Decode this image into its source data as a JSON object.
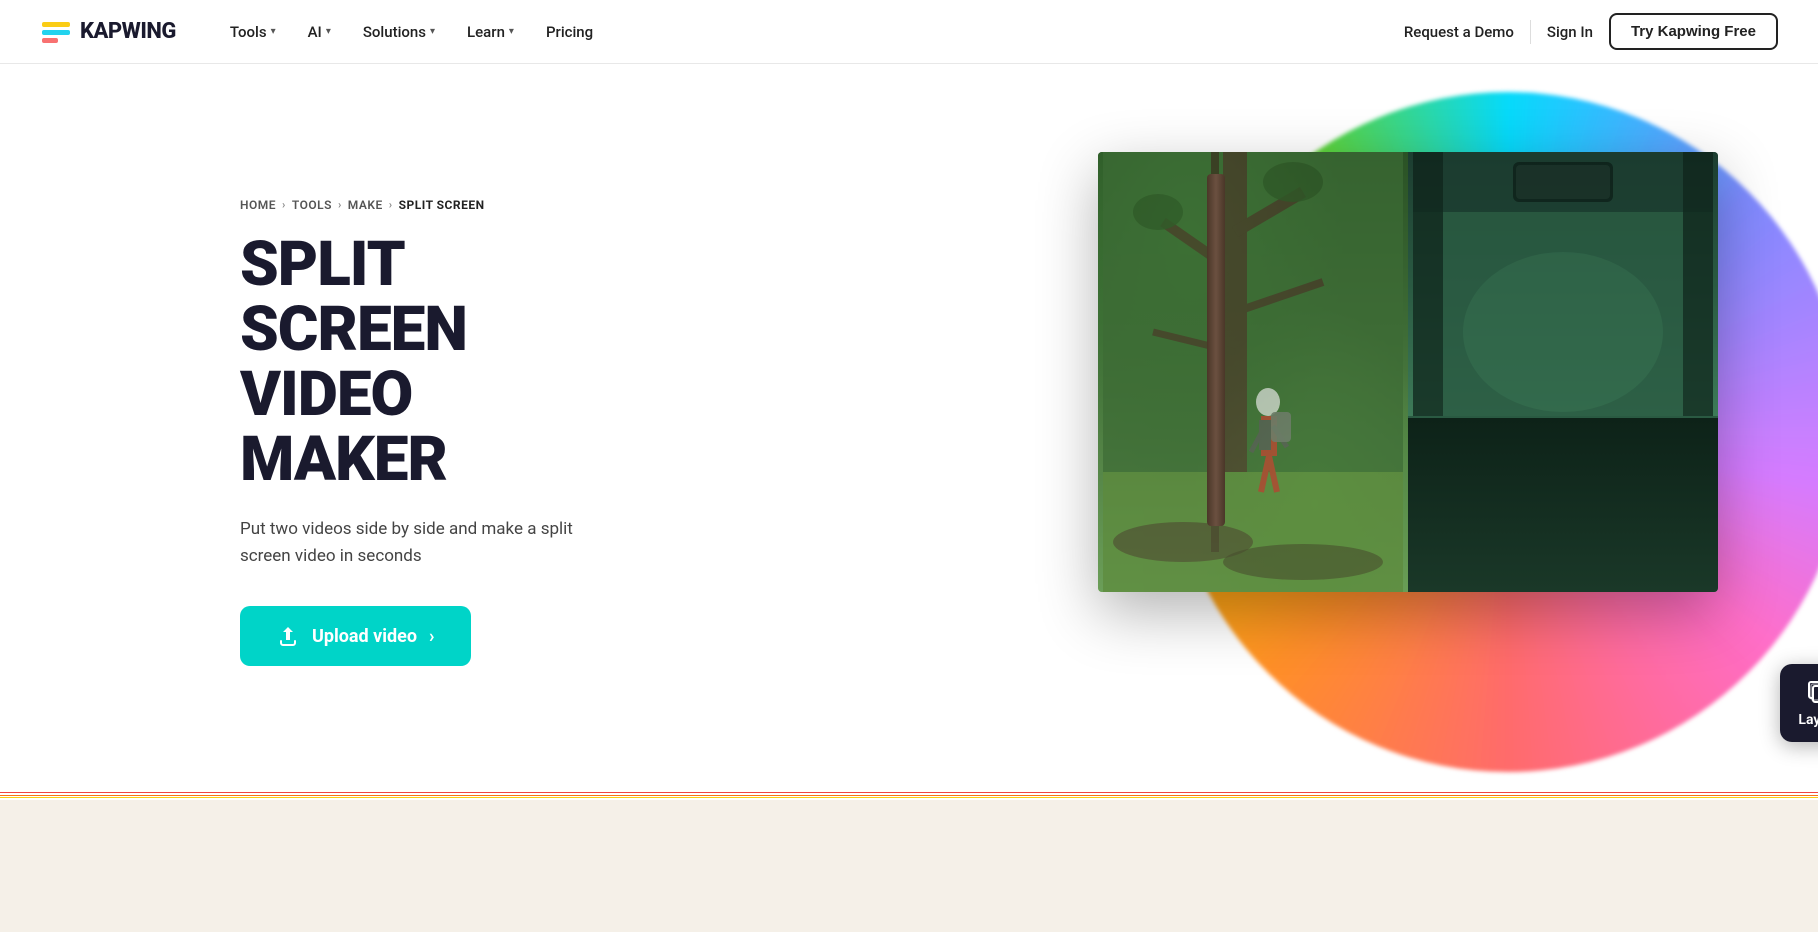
{
  "nav": {
    "logo_text": "KAPWING",
    "links": [
      {
        "label": "Tools",
        "has_dropdown": true
      },
      {
        "label": "AI",
        "has_dropdown": true
      },
      {
        "label": "Solutions",
        "has_dropdown": true
      },
      {
        "label": "Learn",
        "has_dropdown": true
      },
      {
        "label": "Pricing",
        "has_dropdown": false
      }
    ],
    "request_demo": "Request a Demo",
    "sign_in": "Sign In",
    "try_free": "Try Kapwing Free"
  },
  "breadcrumb": {
    "home": "HOME",
    "tools": "TOOLS",
    "make": "MAKE",
    "current": "SPLIT SCREEN"
  },
  "hero": {
    "title_line1": "SPLIT SCREEN",
    "title_line2": "VIDEO MAKER",
    "description": "Put two videos side by side and make a split screen video in seconds",
    "upload_btn": "Upload video"
  },
  "layers_badge": {
    "label": "Layers"
  },
  "colors": {
    "upload_btn_bg": "#00d4c8",
    "accent_red": "#ef4444",
    "accent_orange": "#f97316",
    "accent_yellow": "#facc15",
    "accent_green": "#22c55e"
  }
}
